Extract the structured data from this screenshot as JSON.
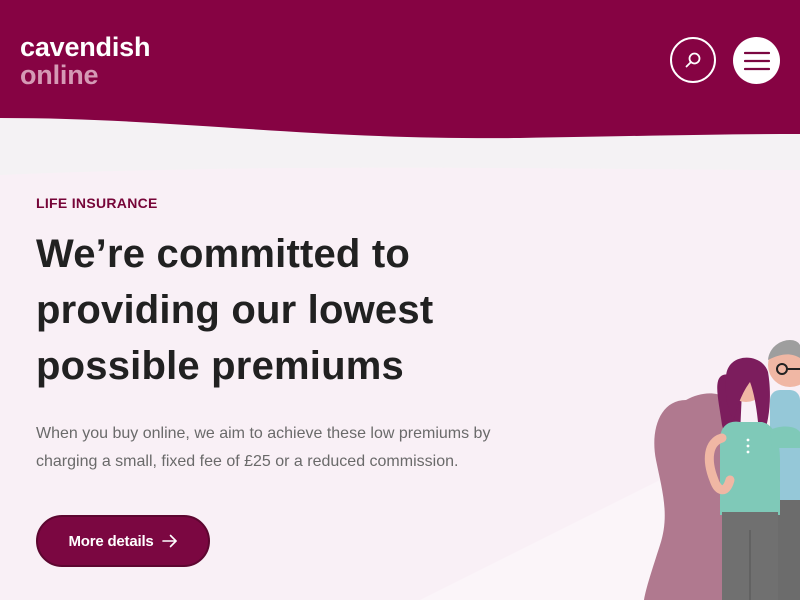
{
  "header": {
    "logo_line1": "cavendish",
    "logo_line2": "online",
    "search_icon": "search-icon",
    "menu_icon": "hamburger-icon",
    "brand_color": "#860343",
    "logo_accent_color": "#d59ab5"
  },
  "hero": {
    "eyebrow": "LIFE INSURANCE",
    "headline": "We’re committed to providing our lowest possible premiums",
    "description": "When you buy online, we aim to achieve these low premiums by charging a small, fixed fee of £25 or a reduced commission.",
    "cta_label": "More details",
    "cta_icon": "arrow-right-icon",
    "text_color": "#212121",
    "muted_text_color": "#6a6a6a"
  }
}
